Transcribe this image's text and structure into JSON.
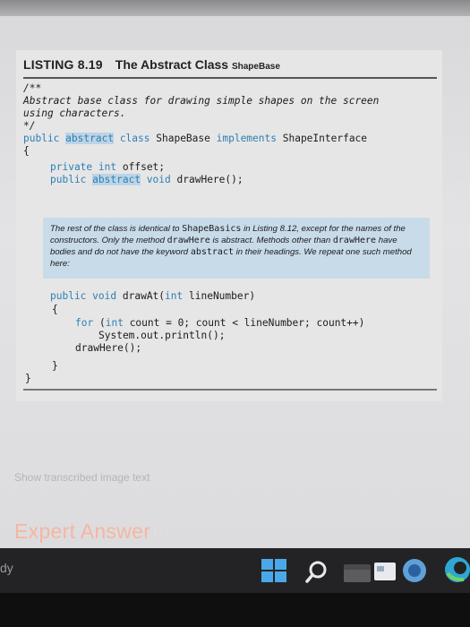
{
  "listing": {
    "number": "LISTING 8.19",
    "title": "The Abstract Class",
    "class_label": "ShapeBase"
  },
  "code": {
    "l1": "/**",
    "l2": "Abstract base class for drawing simple shapes on the screen",
    "l3": "using characters.",
    "l4": "*/",
    "l5_public": "public",
    "l5_abstract": "abstract",
    "l5_class": "class",
    "l5_name": "ShapeBase",
    "l5_implements": "implements",
    "l5_iface": "ShapeInterface",
    "l6": "{",
    "l7_private": "private",
    "l7_int": "int",
    "l7_rest": "offset;",
    "l8_public": "public",
    "l8_abstract": "abstract",
    "l8_void": "void",
    "l8_rest": "drawHere();",
    "l9_public": "public",
    "l9_void": "void",
    "l9_mid": "drawAt(",
    "l9_int": "int",
    "l9_rest": "lineNumber)",
    "l10": "{",
    "l11_for": "for",
    "l11_open": "(",
    "l11_int": "int",
    "l11_rest": "count = 0; count < lineNumber; count++)",
    "l12": "System.out.println();",
    "l13": "drawHere();",
    "l14": "}",
    "l15": "}"
  },
  "note": {
    "p1": "The rest of the class is identical to",
    "m1": "ShapeBasics",
    "p2": "in Listing 8.12, except for the names",
    "p3": "of the constructors. Only the method",
    "m2": "drawHere",
    "p4": "is abstract. Methods other than",
    "m3": "drawHere",
    "p5": "have bodies and do not have the keyword",
    "m4": "abstract",
    "p6": "in their headings. We",
    "p7": "repeat one such method here:"
  },
  "page": {
    "show_transcribed": "Show transcribed image text",
    "expert_answer": "Expert Answer",
    "ready": "dy"
  },
  "icons": {
    "info": "info-icon",
    "windows": "windows-logo-icon",
    "search": "search-icon",
    "file_explorer": "file-explorer-icon",
    "store": "store-icon",
    "chat": "chat-icon",
    "edge": "edge-icon"
  },
  "colors": {
    "keyword": "#2d7fb3",
    "note_bg": "#c8dbe9",
    "expert": "#f4b6a2"
  }
}
